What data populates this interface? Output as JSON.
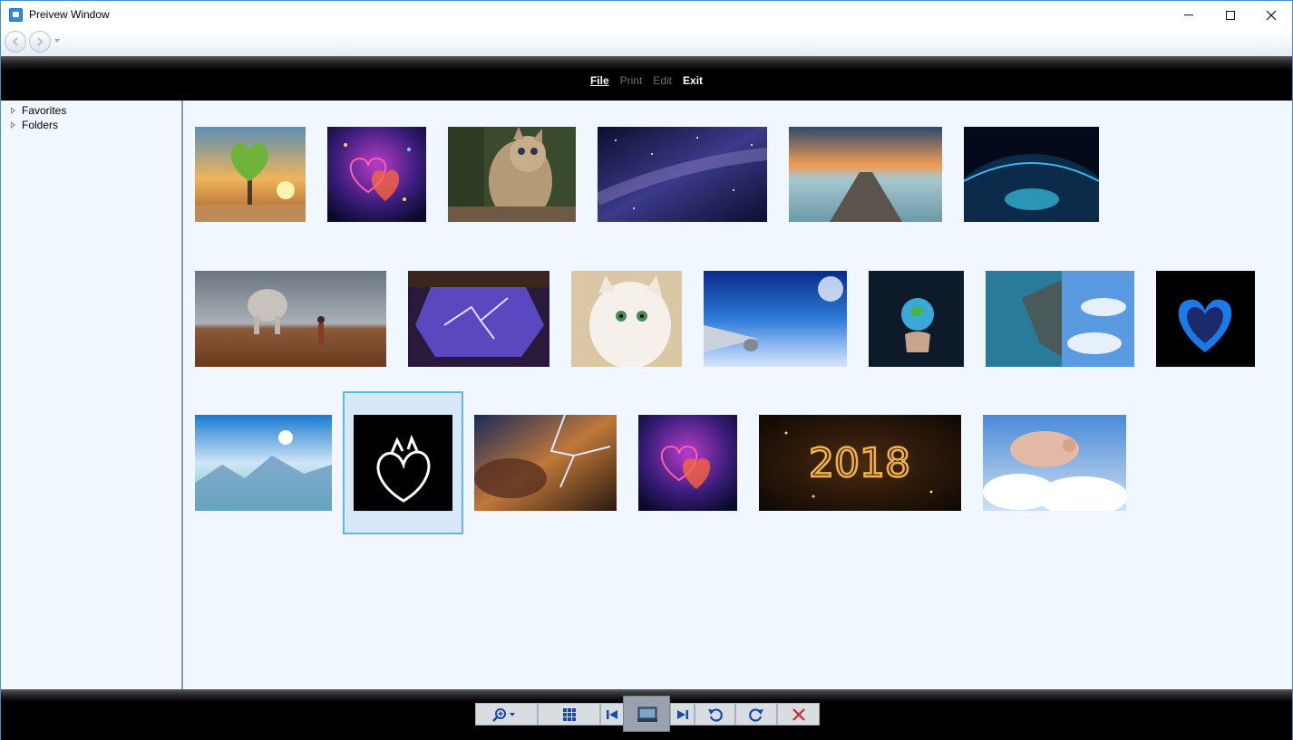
{
  "window": {
    "title": "Preivew Window"
  },
  "menu": {
    "file": "File",
    "print": "Print",
    "edit": "Edit",
    "exit": "Exit"
  },
  "tree": {
    "items": [
      {
        "label": "Favorites"
      },
      {
        "label": "Folders"
      }
    ]
  },
  "gallery": {
    "selected_index": 14,
    "thumbnails": [
      {
        "subject": "heart tree on book at sunset"
      },
      {
        "subject": "neon hearts on purple background"
      },
      {
        "subject": "kitten with raised paws"
      },
      {
        "subject": "starry milky way sky"
      },
      {
        "subject": "wooden pier at sunset"
      },
      {
        "subject": "earth city lights at night"
      },
      {
        "subject": "man facing giant elephant in desert"
      },
      {
        "subject": "purple lightning through window"
      },
      {
        "subject": "white kitten with green eyes"
      },
      {
        "subject": "airplane wing above clouds"
      },
      {
        "subject": "hand holding glowing earth"
      },
      {
        "subject": "surreal split landscape with clouds"
      },
      {
        "subject": "blue flaming heart"
      },
      {
        "subject": "misty blue mountains"
      },
      {
        "subject": "white heart outline on black"
      },
      {
        "subject": "lightning over clouds"
      },
      {
        "subject": "neon hearts on purple background"
      },
      {
        "subject": "2018 sparkler numbers"
      },
      {
        "subject": "flying pig in clouds"
      }
    ]
  },
  "toolbar": {
    "buttons": [
      {
        "icon": "zoom-in-icon"
      },
      {
        "icon": "grid-view-icon"
      },
      {
        "icon": "first-image-icon"
      },
      {
        "icon": "slideshow-icon"
      },
      {
        "icon": "last-image-icon"
      },
      {
        "icon": "rotate-left-icon"
      },
      {
        "icon": "rotate-right-icon"
      },
      {
        "icon": "delete-icon"
      }
    ]
  },
  "colors": {
    "accent": "#62b6df",
    "pane_bg": "#f0f7ff",
    "bar_bg": "#000000",
    "delete": "#d0262f"
  }
}
